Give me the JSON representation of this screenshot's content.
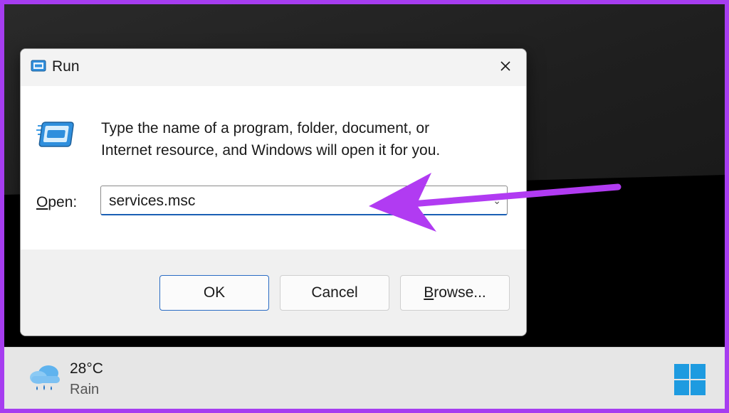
{
  "dialog": {
    "title": "Run",
    "close_label": "Close",
    "description_line1": "Type the name of a program, folder, document, or",
    "description_line2": "Internet resource, and Windows will open it for you.",
    "open_label_accel": "O",
    "open_label_rest": "pen:",
    "open_value": "services.msc",
    "buttons": {
      "ok": "OK",
      "cancel": "Cancel",
      "browse_accel": "B",
      "browse_rest": "rowse..."
    }
  },
  "taskbar": {
    "weather_temp": "28°C",
    "weather_condition": "Rain"
  },
  "colors": {
    "annotation_arrow": "#b13bf2",
    "border": "#a63df0",
    "accent": "#1a5fb4",
    "windows_logo": "#1e9be0"
  },
  "icons": {
    "title": "run-app-icon",
    "body": "run-app-icon",
    "close": "close-icon",
    "weather": "cloud-rain-icon",
    "start": "windows-logo-icon",
    "dropdown": "chevron-down-icon"
  }
}
